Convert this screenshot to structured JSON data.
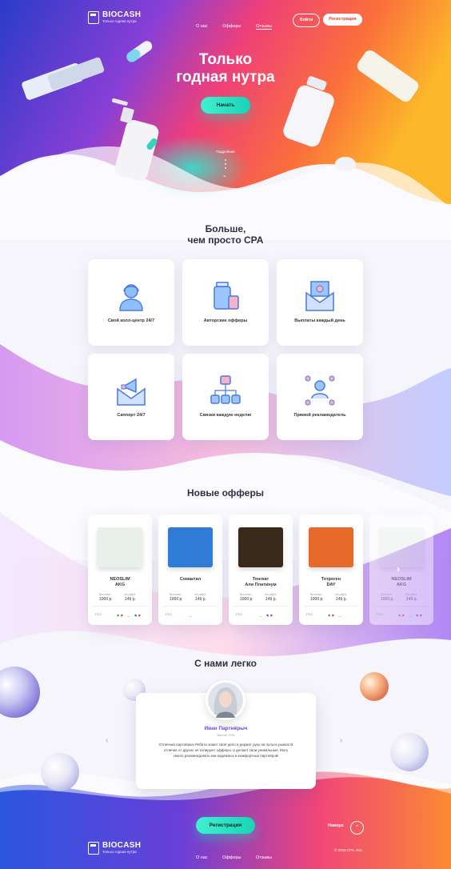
{
  "header": {
    "brand": "BIOCASH",
    "tagline": "Только годная нутра",
    "nav": [
      "О нас",
      "Офферы",
      "Отзывы"
    ],
    "login_label": "Войти",
    "register_label": "Регистрация"
  },
  "hero": {
    "title_line1": "Только",
    "title_line2": "годная нутра",
    "cta_label": "Начать",
    "more_label": "Подробнее"
  },
  "features": {
    "title_line1": "Больше,",
    "title_line2": "чем просто CPA",
    "items": [
      {
        "label": "Свой колл-центр 24/7",
        "icon": "operator-icon"
      },
      {
        "label": "Авторские офферы",
        "icon": "products-icon"
      },
      {
        "label": "Выплаты каждый день",
        "icon": "payout-envelope-icon"
      },
      {
        "label": "Саппорт 24/7",
        "icon": "support-megaphone-icon"
      },
      {
        "label": "Связки каждую неделю",
        "icon": "network-icon"
      },
      {
        "label": "Прямой рекламодатель",
        "icon": "advertiser-icon"
      }
    ]
  },
  "offers": {
    "title": "Новые офферы",
    "price_label": "Выплата",
    "cost_label": "На сайте",
    "geo_label": "ГЕО",
    "items": [
      {
        "name_line1": "NEOSLIM",
        "name_line2": "AKG",
        "payout": "1000 р.",
        "price": "149 р.",
        "flags": [
          "it",
          "ru",
          "fr"
        ]
      },
      {
        "name_line1": "Сомактал",
        "name_line2": "",
        "payout": "1000 р.",
        "price": "149 р.",
        "flags": [
          "ru"
        ]
      },
      {
        "name_line1": "Тонгкат",
        "name_line2": "Али Платинум",
        "payout": "1000 р.",
        "price": "149 р.",
        "flags": [
          "ru",
          "fr"
        ]
      },
      {
        "name_line1": "Тетроген",
        "name_line2": "DAY",
        "payout": "1000 р.",
        "price": "149 р.",
        "flags": [
          "it",
          "ru"
        ]
      },
      {
        "name_line1": "NEOSLIM",
        "name_line2": "AKG",
        "payout": "1000 р.",
        "price": "149 р.",
        "flags": [
          "it",
          "ru",
          "fr"
        ]
      }
    ]
  },
  "testimonials": {
    "title": "С нами легко",
    "name": "Иван Партнёрыч",
    "role": "Биолог CPA",
    "text": "Отличная партнёрка! Ребята знают своё дело и держат руку на пульсе рынка! В отличие от других не копируют офферы, а делают свои уникальные. Могу смело рекомендовать как надёжных и комфортных партнёров!"
  },
  "footer": {
    "register_label": "Регистрация",
    "up_label": "Наверх",
    "brand": "BIOCASH",
    "tagline": "Только годная нутра",
    "nav": [
      "О нас",
      "Офферы",
      "Отзывы"
    ],
    "copyright": "© 2018 CPA, INC."
  },
  "colors": {
    "accent": "#2fe3c3",
    "brand_red": "#e2412c",
    "purple": "#6f46d8"
  }
}
